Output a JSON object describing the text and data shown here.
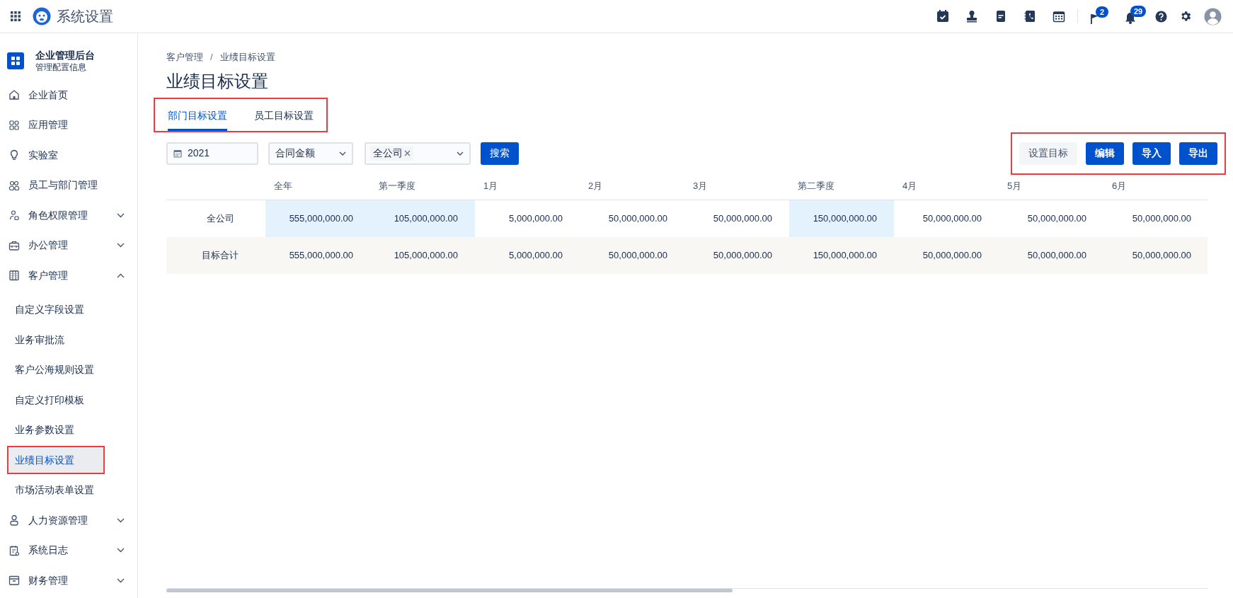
{
  "app_bar": {
    "title": "系统设置",
    "badges": [
      "2",
      "29"
    ]
  },
  "sidebar": {
    "org_name": "企业管理后台",
    "org_subtitle": "管理配置信息",
    "items": [
      {
        "label": "企业首页"
      },
      {
        "label": "应用管理"
      },
      {
        "label": "实验室"
      },
      {
        "label": "员工与部门管理"
      },
      {
        "label": "角色权限管理",
        "expanded": false
      },
      {
        "label": "办公管理",
        "expanded": false
      },
      {
        "label": "客户管理",
        "expanded": true,
        "children": [
          {
            "label": "自定义字段设置",
            "selected": false,
            "highlighted": false
          },
          {
            "label": "业务审批流",
            "selected": false,
            "highlighted": false
          },
          {
            "label": "客户公海规则设置",
            "selected": false,
            "highlighted": false
          },
          {
            "label": "自定义打印模板",
            "selected": false,
            "highlighted": false
          },
          {
            "label": "业务参数设置",
            "selected": false,
            "highlighted": false
          },
          {
            "label": "业绩目标设置",
            "selected": true,
            "highlighted": true
          },
          {
            "label": "市场活动表单设置",
            "selected": false,
            "highlighted": false
          }
        ]
      },
      {
        "label": "人力资源管理",
        "expanded": false
      },
      {
        "label": "系统日志",
        "expanded": false
      },
      {
        "label": "财务管理",
        "expanded": false
      }
    ]
  },
  "breadcrumb": [
    "客户管理",
    "/",
    "业绩目标设置"
  ],
  "page_title": "业绩目标设置",
  "tabs_highlighted": true,
  "tabs": [
    {
      "label": "部门目标设置",
      "selected": true
    },
    {
      "label": "员工目标设置",
      "selected": false
    }
  ],
  "filters": {
    "year": "2021",
    "metric": "合同金额",
    "scope_tag": "全公司",
    "search_button": "搜索"
  },
  "actions_highlighted": true,
  "actions": [
    {
      "label": "设置目标",
      "kind": "secondary"
    },
    {
      "label": "编辑",
      "kind": "primary"
    },
    {
      "label": "导入",
      "kind": "primary"
    },
    {
      "label": "导出",
      "kind": "primary"
    }
  ],
  "table": {
    "columns": [
      {
        "label": "全年",
        "summary": true
      },
      {
        "label": "第一季度",
        "summary": true
      },
      {
        "label": "1月",
        "summary": false
      },
      {
        "label": "2月",
        "summary": false
      },
      {
        "label": "3月",
        "summary": false
      },
      {
        "label": "第二季度",
        "summary": true
      },
      {
        "label": "4月",
        "summary": false
      },
      {
        "label": "5月",
        "summary": false
      },
      {
        "label": "6月",
        "summary": false
      }
    ],
    "rows": [
      {
        "kind": "company",
        "label": "全公司",
        "values": [
          "555,000,000.00",
          "105,000,000.00",
          "5,000,000.00",
          "50,000,000.00",
          "50,000,000.00",
          "150,000,000.00",
          "50,000,000.00",
          "50,000,000.00",
          "50,000,000.00"
        ]
      },
      {
        "kind": "total",
        "label": "目标合计",
        "values": [
          "555,000,000.00",
          "105,000,000.00",
          "5,000,000.00",
          "50,000,000.00",
          "50,000,000.00",
          "150,000,000.00",
          "50,000,000.00",
          "50,000,000.00",
          "50,000,000.00"
        ]
      }
    ]
  }
}
